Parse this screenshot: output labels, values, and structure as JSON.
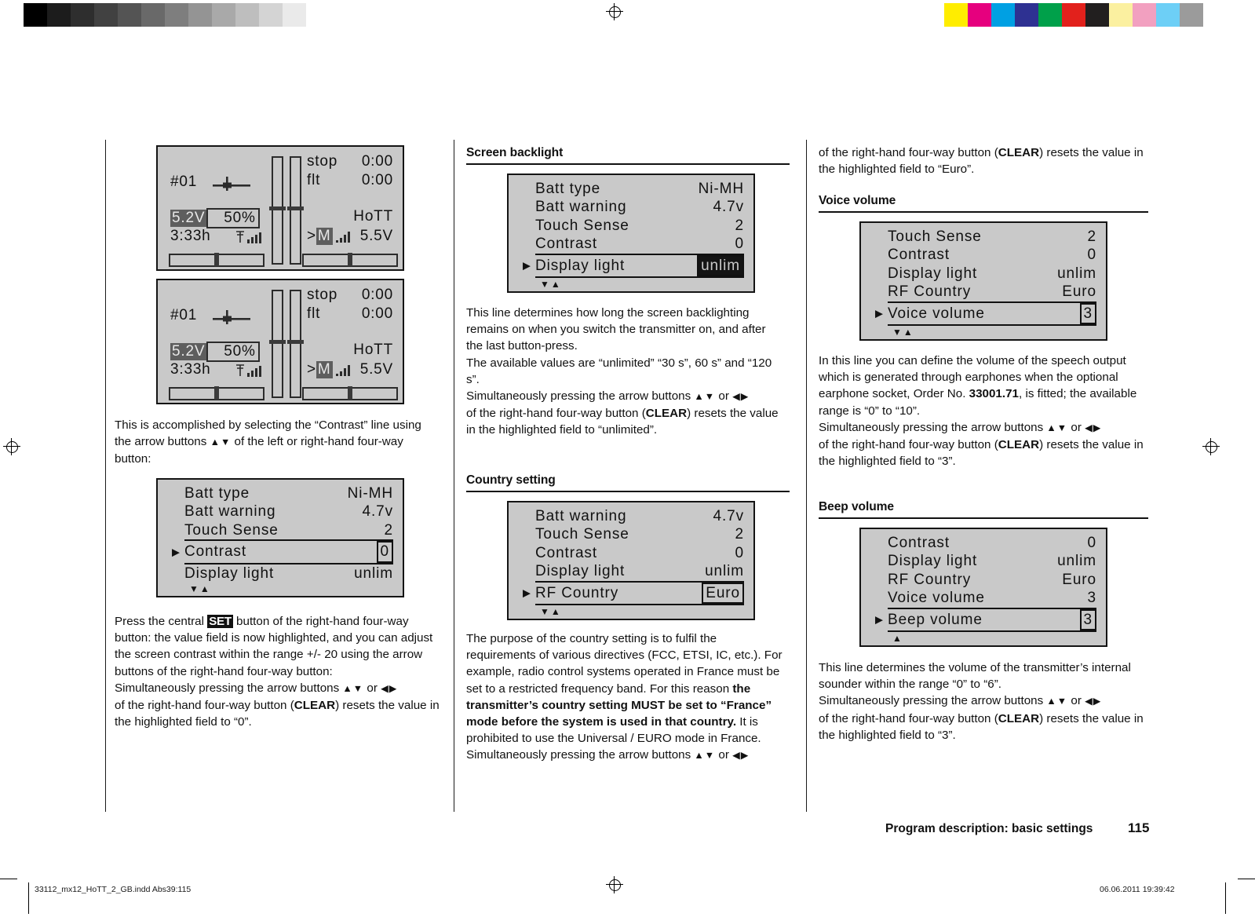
{
  "calibration": {
    "grey_swatches": [
      "#000000",
      "#1c1c1c",
      "#2e2e2e",
      "#414141",
      "#545454",
      "#696969",
      "#7e7e7e",
      "#949494",
      "#a9a9a9",
      "#bebebe",
      "#d4d4d4",
      "#eaeaea",
      "#ffffff"
    ],
    "color_swatches": [
      "#ffed00",
      "#e6007e",
      "#00a0e3",
      "#2e3192",
      "#00a04a",
      "#e2211c",
      "#221f1f",
      "#fbf0a0",
      "#f2a0c0",
      "#6dcff6",
      "#9b9b9b"
    ]
  },
  "status_screens": [
    {
      "model_no": "#01",
      "icon": "aeroplane-icon",
      "timer_label_1": "stop",
      "timer_value_1": "0:00",
      "timer_label_2": "flt",
      "timer_value_2": "0:00",
      "tx_voltage": "5.2V",
      "tx_percent": "50%",
      "run_time": "3:33h",
      "antenna_icon": "antenna-signal-icon",
      "system": "HoTT",
      "rx_marker": ">",
      "rx_mode": "M",
      "rx_signal_icon": "rx-signal-icon",
      "rx_voltage": "5.5V"
    },
    {
      "model_no": "#01",
      "icon": "aeroplane-icon",
      "timer_label_1": "stop",
      "timer_value_1": "0:00",
      "timer_label_2": "flt",
      "timer_value_2": "0:00",
      "tx_voltage": "5.2V",
      "tx_percent": "50%",
      "run_time": "3:33h",
      "antenna_icon": "antenna-signal-icon",
      "system": "HoTT",
      "rx_marker": ">",
      "rx_mode": "M",
      "rx_signal_icon": "rx-signal-icon",
      "rx_voltage": "5.5V"
    }
  ],
  "column1": {
    "paragraph1_a": "This is accomplished by selecting the “Contrast” line using the arrow buttons ",
    "arrows_ud": "▲▼",
    "paragraph1_b": " of the left or right-hand four-way button:",
    "lcd_contrast": {
      "rows": [
        {
          "label": "Batt  type",
          "value": "Ni-MH",
          "selected": false,
          "value_style": "plain"
        },
        {
          "label": "Batt  warning",
          "value": "4.7v",
          "selected": false,
          "value_style": "plain"
        },
        {
          "label": "Touch  Sense",
          "value": "2",
          "selected": false,
          "value_style": "plain"
        },
        {
          "label": "Contrast",
          "value": "0",
          "selected": true,
          "value_style": "box"
        },
        {
          "label": "Display  light",
          "value": "unlim",
          "selected": false,
          "value_style": "plain"
        }
      ],
      "scroll_indicator": "▼▲"
    },
    "paragraph2_a": "Press the central ",
    "set_key": "SET",
    "paragraph2_b": " button of the right-hand four-way button: the value field is now highlighted, and you can adjust the screen contrast within the range +/- 20 using the arrow buttons of the right-hand four-way button:",
    "paragraph3_a": "Simultaneously pressing the arrow buttons ",
    "arrows_lr": "◀▶",
    "paragraph3_or": " or ",
    "paragraph3_b": "of the right-hand four-way button (",
    "clear_key": "CLEAR",
    "paragraph3_c": ") resets the value in the highlighted field to “0”."
  },
  "column2": {
    "heading_backlight": "Screen backlight",
    "lcd_display_light": {
      "rows": [
        {
          "label": "Batt  type",
          "value": "Ni-MH",
          "selected": false,
          "value_style": "plain"
        },
        {
          "label": "Batt  warning",
          "value": "4.7v",
          "selected": false,
          "value_style": "plain"
        },
        {
          "label": "Touch  Sense",
          "value": "2",
          "selected": false,
          "value_style": "plain"
        },
        {
          "label": "Contrast",
          "value": "0",
          "selected": false,
          "value_style": "plain"
        },
        {
          "label": "Display  light",
          "value": "unlim",
          "selected": true,
          "value_style": "inverse"
        }
      ],
      "scroll_indicator": "▼▲"
    },
    "p1": "This line determines how long the screen backlighting remains on when you switch the transmitter on, and after the last button-press.",
    "p2": "The available values are “unlimited” “30 s”, 60 s” and “120 s”.",
    "p3_a": "Simultaneously pressing the arrow buttons ",
    "p3_or": " or ",
    "p3_b": "of the right-hand four-way button (",
    "clear_key": "CLEAR",
    "p3_c": ") resets the value in the highlighted field to “unlimited”.",
    "heading_country": "Country setting",
    "lcd_country": {
      "rows": [
        {
          "label": "Batt  warning",
          "value": "4.7v",
          "selected": false,
          "value_style": "plain"
        },
        {
          "label": "Touch  Sense",
          "value": "2",
          "selected": false,
          "value_style": "plain"
        },
        {
          "label": "Contrast",
          "value": "0",
          "selected": false,
          "value_style": "plain"
        },
        {
          "label": "Display  light",
          "value": "unlim",
          "selected": false,
          "value_style": "plain"
        },
        {
          "label": "RF  Country",
          "value": "Euro",
          "selected": true,
          "value_style": "box"
        }
      ],
      "scroll_indicator": "▼▲"
    },
    "p4_a": "The purpose of the country setting is to fulfil the requirements of various directives (FCC, ETSI, IC, etc.). For example, radio control systems operated in France must be set to a restricted frequency band. For this reason ",
    "p4_bold": "the transmitter’s country setting MUST be set to “France” mode before the system is used in that country.",
    "p4_b": " It is prohibited to use the Universal / EURO mode in France.",
    "p5_a": "Simultaneously pressing the arrow buttons ",
    "p5_or": " or "
  },
  "column3": {
    "p0_a": "of the right-hand four-way button (",
    "clear_key": "CLEAR",
    "p0_b": ") resets the value in the highlighted field to “Euro”.",
    "heading_voice": "Voice volume",
    "lcd_voice": {
      "rows": [
        {
          "label": "Touch  Sense",
          "value": "2",
          "selected": false,
          "value_style": "plain"
        },
        {
          "label": "Contrast",
          "value": "0",
          "selected": false,
          "value_style": "plain"
        },
        {
          "label": "Display  light",
          "value": "unlim",
          "selected": false,
          "value_style": "plain"
        },
        {
          "label": "RF  Country",
          "value": "Euro",
          "selected": false,
          "value_style": "plain"
        },
        {
          "label": "Voice  volume",
          "value": "3",
          "selected": true,
          "value_style": "box"
        }
      ],
      "scroll_indicator": "▼▲"
    },
    "p1_a": "In this line you can define the volume of the speech output which is generated through earphones when the optional earphone socket, Order No. ",
    "order_no": "33001.71",
    "p1_b": ", is fitted; the available range is “0” to “10”.",
    "p2_a": "Simultaneously pressing the arrow buttons ",
    "p2_or": " or ",
    "p2_b": "of the right-hand four-way button (",
    "p2_c": ") resets the value in the highlighted field to “3”.",
    "heading_beep": "Beep volume",
    "lcd_beep": {
      "rows": [
        {
          "label": "Contrast",
          "value": "0",
          "selected": false,
          "value_style": "plain"
        },
        {
          "label": "Display  light",
          "value": "unlim",
          "selected": false,
          "value_style": "plain"
        },
        {
          "label": "RF  Country",
          "value": "Euro",
          "selected": false,
          "value_style": "plain"
        },
        {
          "label": "Voice  volume",
          "value": "3",
          "selected": false,
          "value_style": "plain"
        },
        {
          "label": "Beep  volume",
          "value": "3",
          "selected": true,
          "value_style": "box"
        }
      ],
      "scroll_indicator": "▲"
    },
    "p3": "This line determines the volume of the transmitter’s internal sounder within the range “0” to “6”.",
    "p4_a": "Simultaneously pressing the arrow buttons ",
    "p4_or": " or ",
    "p4_b": "of the right-hand four-way button (",
    "p4_c": ") resets the value in the highlighted field to “3”."
  },
  "footer": {
    "running_head": "Program description: basic settings",
    "page_number": "115",
    "file_info": "33112_mx12_HoTT_2_GB.indd   Abs39:115",
    "print_stamp": "06.06.2011   19:39:42"
  },
  "glyphs": {
    "arrows_ud": "▲▼",
    "arrows_lr": "◀▶",
    "cursor": "▶"
  }
}
